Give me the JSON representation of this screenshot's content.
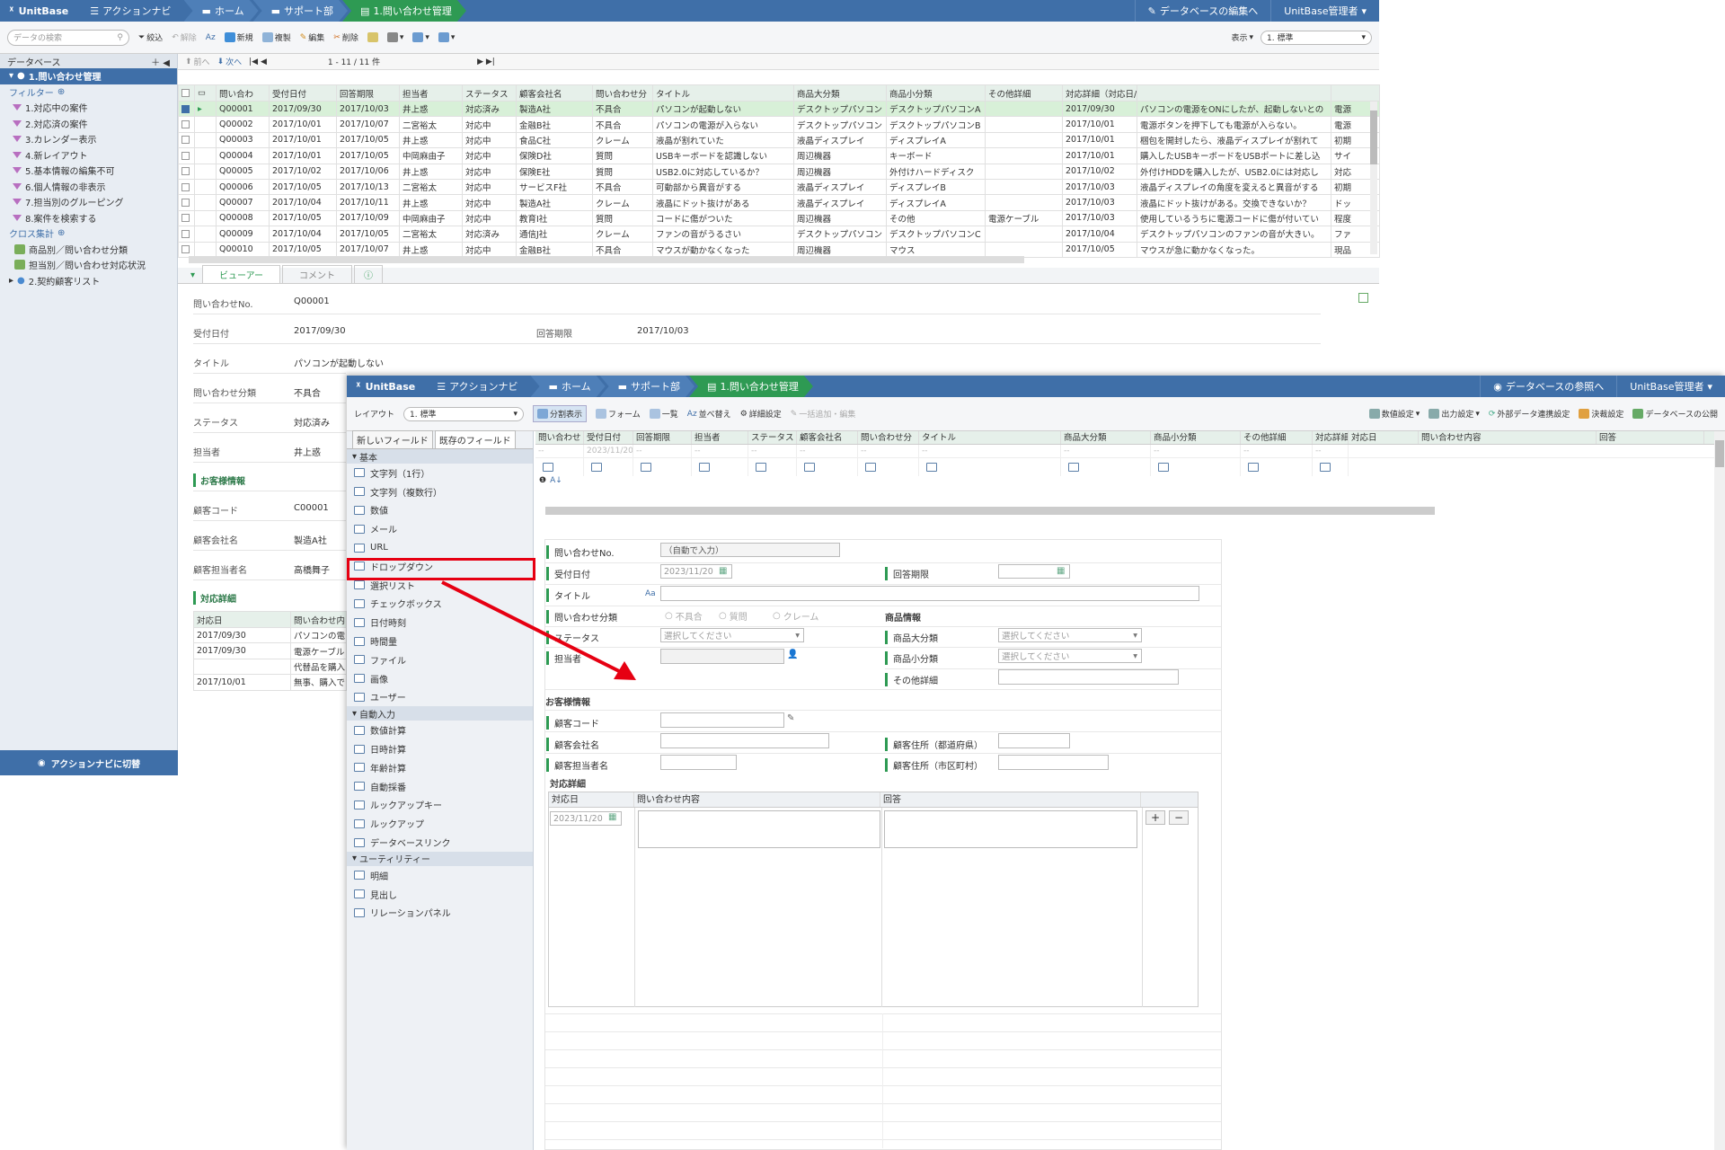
{
  "brand": "UnitBase",
  "back": {
    "nav": "アクションナビ",
    "crumbs": [
      "ホーム",
      "サポート部",
      "1.問い合わせ管理"
    ],
    "db_edit": "データベースの編集へ",
    "user": "UnitBase管理者",
    "search_placeholder": "データの検索",
    "tools": {
      "filter": "絞込",
      "undo": "解除",
      "az": "Az",
      "new": "新規",
      "copy": "複製",
      "edit": "編集",
      "delete": "削除",
      "print": "",
      "display": "表示",
      "layout": "1. 標準"
    },
    "pager": {
      "prev": "前へ",
      "next": "次へ",
      "range": "1 - 11 / 11 件"
    },
    "sidebar": {
      "db_header": "データベース",
      "db_selected": "1.問い合わせ管理",
      "filter_header": "フィルター",
      "filters": [
        "1.対応中の案件",
        "2.対応済の案件",
        "3.カレンダー表示",
        "4.新レイアウト",
        "5.基本情報の編集不可",
        "6.個人情報の非表示",
        "7.担当別のグルーピング",
        "8.案件を検索する"
      ],
      "cross_header": "クロス集計",
      "cross": [
        "商品別／問い合わせ分類",
        "担当別／問い合わせ対応状況"
      ],
      "db2": "2.契約顧客リスト",
      "action_btn": "アクションナビに切替"
    },
    "columns": [
      "問い合わ",
      "受付日付",
      "回答期限",
      "担当者",
      "ステータス",
      "顧客会社名",
      "問い合わせ分",
      "タイトル",
      "商品大分類",
      "商品小分類",
      "その他詳細",
      "対応詳細（対応日/問い合わせ内容/回答）",
      "",
      "",
      ""
    ],
    "rows": [
      [
        "Q00001",
        "2017/09/30",
        "2017/10/03",
        "井上惑",
        "対応済み",
        "製造A社",
        "不具合",
        "パソコンが起動しない",
        "デスクトップパソコン",
        "デスクトップパソコンA",
        "",
        "2017/09/30",
        "パソコンの電源をONにしたが、起動しないとの",
        "電源"
      ],
      [
        "Q00002",
        "2017/10/01",
        "2017/10/07",
        "二宮裕太",
        "対応中",
        "金融B社",
        "不具合",
        "パソコンの電源が入らない",
        "デスクトップパソコン",
        "デスクトップパソコンB",
        "",
        "2017/10/01",
        "電源ボタンを押下しても電源が入らない。",
        "電源"
      ],
      [
        "Q00003",
        "2017/10/01",
        "2017/10/05",
        "井上惑",
        "対応中",
        "食品C社",
        "クレーム",
        "液晶が割れていた",
        "液晶ディスプレイ",
        "ディスプレイA",
        "",
        "2017/10/01",
        "梱包を開封したら、液晶ディスプレイが割れて",
        "初期"
      ],
      [
        "Q00004",
        "2017/10/01",
        "2017/10/05",
        "中岡麻由子",
        "対応中",
        "保険D社",
        "質問",
        "USBキーボードを認識しない",
        "周辺機器",
        "キーボード",
        "",
        "2017/10/01",
        "購入したUSBキーボードをUSBポートに差し込",
        "サイ"
      ],
      [
        "Q00005",
        "2017/10/02",
        "2017/10/06",
        "井上惑",
        "対応中",
        "保険E社",
        "質問",
        "USB2.0に対応しているか？",
        "周辺機器",
        "外付けハードディスク",
        "",
        "2017/10/02",
        "外付けHDDを購入したが、USB2.0には対応し",
        "対応"
      ],
      [
        "Q00006",
        "2017/10/05",
        "2017/10/13",
        "二宮裕太",
        "対応中",
        "サービスF社",
        "不具合",
        "可動部から異音がする",
        "液晶ディスプレイ",
        "ディスプレイB",
        "",
        "2017/10/03",
        "液晶ディスプレイの角度を変えると異音がする",
        "初期"
      ],
      [
        "Q00007",
        "2017/10/04",
        "2017/10/11",
        "井上惑",
        "対応中",
        "製造A社",
        "クレーム",
        "液晶にドット抜けがある",
        "液晶ディスプレイ",
        "ディスプレイA",
        "",
        "2017/10/03",
        "液晶にドット抜けがある。交換できないか？",
        "ドッ"
      ],
      [
        "Q00008",
        "2017/10/05",
        "2017/10/09",
        "中岡麻由子",
        "対応中",
        "教育I社",
        "質問",
        "コードに傷がついた",
        "周辺機器",
        "その他",
        "電源ケーブル",
        "2017/10/03",
        "使用しているうちに電源コードに傷が付いてい",
        "程度"
      ],
      [
        "Q00009",
        "2017/10/04",
        "2017/10/05",
        "二宮裕太",
        "対応済み",
        "通信J社",
        "クレーム",
        "ファンの音がうるさい",
        "デスクトップパソコン",
        "デスクトップパソコンC",
        "",
        "2017/10/04",
        "デスクトップパソコンのファンの音が大きい。",
        "ファ"
      ],
      [
        "Q00010",
        "2017/10/05",
        "2017/10/07",
        "井上惑",
        "対応中",
        "金融B社",
        "不具合",
        "マウスが動かなくなった",
        "周辺機器",
        "マウス",
        "",
        "2017/10/05",
        "マウスが急に動かなくなった。",
        "現品"
      ]
    ],
    "tabs": [
      "ビューアー",
      "コメント"
    ],
    "detail": {
      "no_label": "問い合わせNo.",
      "no": "Q00001",
      "date_label": "受付日付",
      "date": "2017/09/30",
      "deadline_label": "回答期限",
      "deadline": "2017/10/03",
      "title_label": "タイトル",
      "title": "パソコンが起動しない",
      "cat_label": "問い合わせ分類",
      "cat": "不具合",
      "status_label": "ステータス",
      "status": "対応済み",
      "staff_label": "担当者",
      "staff": "井上惑",
      "cust_header": "お客様情報",
      "code_label": "顧客コード",
      "code": "C00001",
      "company_label": "顧客会社名",
      "company": "製造A社",
      "person_label": "顧客担当者名",
      "person": "高橋舞子",
      "resp_header": "対応詳細",
      "resp_cols": [
        "対応日",
        "問い合わせ内"
      ],
      "resp_rows": [
        [
          "2017/09/30",
          "パソコンの電"
        ],
        [
          "2017/09/30",
          "電源ケーブル"
        ],
        [
          "",
          "代替品を購入"
        ],
        [
          "2017/10/01",
          "無事、購入で"
        ]
      ]
    }
  },
  "front": {
    "nav": "アクションナビ",
    "crumbs": [
      "ホーム",
      "サポート部",
      "1.問い合わせ管理"
    ],
    "db_ref": "データベースの参照へ",
    "user": "UnitBase管理者",
    "layout_label": "レイアウト",
    "layout_value": "1. 標準",
    "tools": [
      "分割表示",
      "フォーム",
      "一覧",
      "並べ替え",
      "詳細設定",
      "一括追加・編集"
    ],
    "rtools": [
      "数値設定",
      "出力設定",
      "外部データ連携設定",
      "決裁設定",
      "データベースの公開"
    ],
    "palette_tabs": [
      "新しいフィールド",
      "既存のフィールド"
    ],
    "sections": [
      {
        "name": "基本",
        "items": [
          "文字列（1行）",
          "文字列（複数行）",
          "数値",
          "メール",
          "URL",
          "ドロップダウン",
          "選択リスト",
          "チェックボックス",
          "日付時刻",
          "時間量",
          "ファイル",
          "画像",
          "ユーザー"
        ]
      },
      {
        "name": "自動入力",
        "items": [
          "数値計算",
          "日時計算",
          "年齢計算",
          "自動採番",
          "ルックアップキー",
          "ルックアップ",
          "データベースリンク"
        ]
      },
      {
        "name": "ユーティリティー",
        "items": [
          "明細",
          "見出し",
          "リレーションパネル"
        ]
      }
    ],
    "grid_cols": [
      "問い合わせ",
      "受付日付",
      "回答期限",
      "担当者",
      "ステータス",
      "顧客会社名",
      "問い合わせ分",
      "タイトル",
      "商品大分類",
      "商品小分類",
      "その他詳細",
      "対応詳細"
    ],
    "grid_sub": [
      "対応日",
      "問い合わせ内容",
      "回答"
    ],
    "grid_date": "2023/11/20",
    "grid_dash": "--",
    "form": {
      "no_label": "問い合わせNo.",
      "no_value": "（自動で入力）",
      "date_label": "受付日付",
      "date_value": "2023/11/20",
      "deadline_label": "回答期限",
      "title_label": "タイトル",
      "cat_label": "問い合わせ分類",
      "cat_opts": [
        "不具合",
        "質問",
        "クレーム"
      ],
      "product_header": "商品情報",
      "status_label": "ステータス",
      "select_placeholder": "選択してください",
      "big_label": "商品大分類",
      "staff_label": "担当者",
      "small_label": "商品小分類",
      "other_label": "その他詳細",
      "cust_header": "お客様情報",
      "code_label": "顧客コード",
      "company_label": "顧客会社名",
      "pref_label": "顧客住所（都道府県）",
      "person_label": "顧客担当者名",
      "city_label": "顧客住所（市区町村）",
      "resp_header": "対応詳細",
      "resp_cols": [
        "対応日",
        "問い合わせ内容",
        "回答"
      ],
      "resp_date": "2023/11/20",
      "plus": "+",
      "minus": "−"
    }
  },
  "colors": {
    "header": "#3f6fa8",
    "active": "#2e9a53",
    "highlight": "#e60012"
  }
}
